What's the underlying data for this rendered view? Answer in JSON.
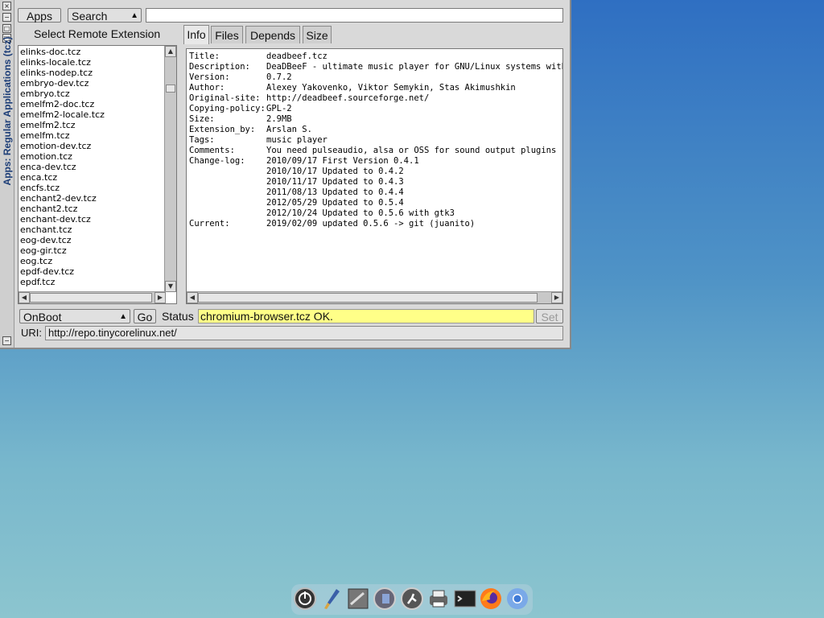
{
  "window": {
    "title": "Apps: Regular Applications (tcz)",
    "apps_label": "Apps",
    "search_label": "Search",
    "search_value": "",
    "select_heading": "Select Remote Extension"
  },
  "extensions": [
    "elinks-doc.tcz",
    "elinks-locale.tcz",
    "elinks-nodep.tcz",
    "embryo-dev.tcz",
    "embryo.tcz",
    "emelfm2-doc.tcz",
    "emelfm2-locale.tcz",
    "emelfm2.tcz",
    "emelfm.tcz",
    "emotion-dev.tcz",
    "emotion.tcz",
    "enca-dev.tcz",
    "enca.tcz",
    "encfs.tcz",
    "enchant2-dev.tcz",
    "enchant2.tcz",
    "enchant-dev.tcz",
    "enchant.tcz",
    "eog-dev.tcz",
    "eog-gir.tcz",
    "eog.tcz",
    "epdf-dev.tcz",
    "epdf.tcz"
  ],
  "tabs": [
    "Info",
    "Files",
    "Depends",
    "Size"
  ],
  "info_rows": [
    {
      "k": "Title:",
      "v": "deadbeef.tcz"
    },
    {
      "k": "Description:",
      "v": "DeaDBeeF - ultimate music player for GNU/Linux systems with X"
    },
    {
      "k": "Version:",
      "v": "0.7.2"
    },
    {
      "k": "Author:",
      "v": "Alexey Yakovenko, Viktor Semykin, Stas Akimushkin"
    },
    {
      "k": "Original-site:",
      "v": "http://deadbeef.sourceforge.net/"
    },
    {
      "k": "Copying-policy:",
      "v": "GPL-2"
    },
    {
      "k": "Size:",
      "v": "2.9MB"
    },
    {
      "k": "Extension_by:",
      "v": "Arslan S."
    },
    {
      "k": "Tags:",
      "v": "music player"
    },
    {
      "k": "Comments:",
      "v": "You need pulseaudio, alsa or OSS for sound output plugins"
    },
    {
      "k": "Change-log:",
      "v": "2010/09/17 First Version 0.4.1"
    },
    {
      "k": "",
      "v": "2010/10/17 Updated to 0.4.2"
    },
    {
      "k": "",
      "v": "2010/11/17 Updated to 0.4.3"
    },
    {
      "k": "",
      "v": "2011/08/13 Updated to 0.4.4"
    },
    {
      "k": "",
      "v": "2012/05/29 Updated to 0.5.4"
    },
    {
      "k": "",
      "v": "2012/10/24 Updated to 0.5.6 with gtk3"
    },
    {
      "k": "Current:",
      "v": "2019/02/09 updated 0.5.6 -> git (juanito)"
    }
  ],
  "bottom": {
    "onboot_label": "OnBoot",
    "go_label": "Go",
    "status_label": "Status",
    "status_value": "chromium-browser.tcz OK.",
    "set_label": "Set",
    "uri_label": "URI:",
    "uri_value": "http://repo.tinycorelinux.net/"
  },
  "dock_icons": [
    "power-icon",
    "brush-icon",
    "terminal-grid-icon",
    "control-panel-icon",
    "run-icon",
    "printer-icon",
    "console-icon",
    "firefox-icon",
    "chromium-icon"
  ]
}
